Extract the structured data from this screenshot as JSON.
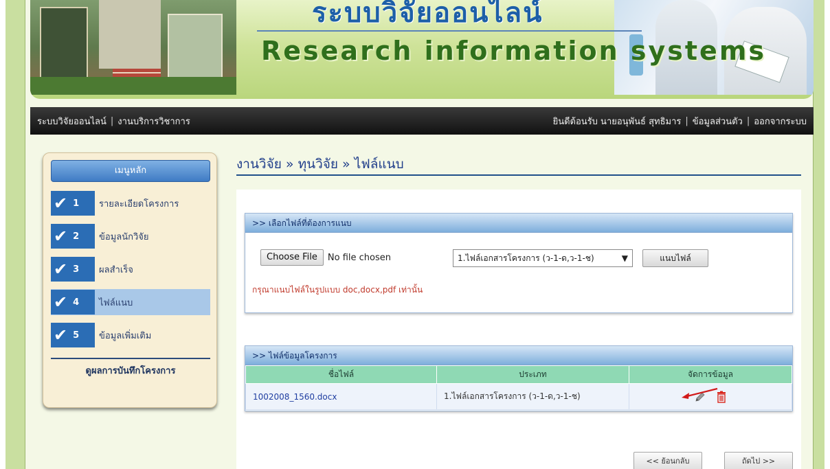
{
  "header": {
    "title_th": "ระบบวิจัยออนไลน์",
    "title_en": "Research information systems"
  },
  "topnav": {
    "home_link": "ระบบวิจัยออนไลน์",
    "section_link": "งานบริการวิชาการ",
    "welcome_text": "ยินดีต้อนรับ นายอนุพันธ์ สุทธิมาร",
    "profile_link": "ข้อมูลส่วนตัว",
    "logout_link": "ออกจากระบบ",
    "separator": "|"
  },
  "sidebar": {
    "menu_title": "เมนูหลัก",
    "items": [
      {
        "num": "1",
        "label": "รายละเอียดโครงการ",
        "active": false
      },
      {
        "num": "2",
        "label": "ข้อมูลนักวิจัย",
        "active": false
      },
      {
        "num": "3",
        "label": "ผลสำเร็จ",
        "active": false
      },
      {
        "num": "4",
        "label": "ไฟล์แนบ",
        "active": true
      },
      {
        "num": "5",
        "label": "ข้อมูลเพิ่มเติม",
        "active": false
      }
    ],
    "summary_link": "ดูผลการบันทึกโครงการ",
    "check_glyph": "✔"
  },
  "breadcrumb": "งานวิจัย » ทุนวิจัย » ไฟล์แนบ",
  "upload_box": {
    "title": ">> เลือกไฟล์ที่ต้องการแนบ",
    "choose_file_label": "Choose File",
    "no_file_text": "No file chosen",
    "file_type_selected": "1.ไฟล์เอกสารโครงการ (ว-1-ด,ว-1-ช)",
    "dropdown_arrow": "▼",
    "attach_button": "แนบไฟล์",
    "hint": "กรุณาแนบไฟล์ในรูปแบบ doc,docx,pdf เท่านั้น"
  },
  "files_box": {
    "title": ">> ไฟล์ข้อมูลโครงการ",
    "columns": [
      "ชื่อไฟล์",
      "ประเภท",
      "จัดการข้อมูล"
    ],
    "rows": [
      {
        "filename": "1002008_1560.docx",
        "type": "1.ไฟล์เอกสารโครงการ (ว-1-ด,ว-1-ช)"
      }
    ]
  },
  "nav_buttons": {
    "back": "<< ย้อนกลับ",
    "next": "ถัดไป >>"
  },
  "colors": {
    "accent_blue": "#2b6db5",
    "table_header_green": "#8fd9b4",
    "hint_red": "#c0392b",
    "annotation_red": "#d11a1a"
  }
}
